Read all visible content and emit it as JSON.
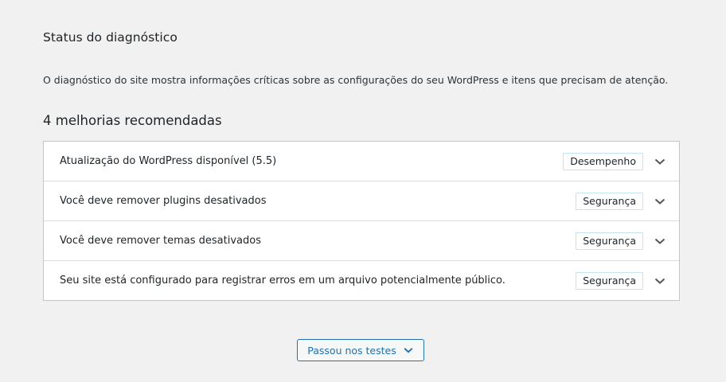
{
  "header": {
    "title": "Status do diagnóstico",
    "description": "O diagnóstico do site mostra informações críticas sobre as configurações do seu WordPress e itens que precisam de atenção."
  },
  "recommendations": {
    "title": "4 melhorias recomendadas",
    "items": [
      {
        "label": "Atualização do WordPress disponível (5.5)",
        "badge": "Desempenho",
        "icon": "chevron-down-icon"
      },
      {
        "label": "Você deve remover plugins desativados",
        "badge": "Segurança",
        "icon": "chevron-down-icon"
      },
      {
        "label": "Você deve remover temas desativados",
        "badge": "Segurança",
        "icon": "chevron-down-icon"
      },
      {
        "label": "Seu site está configurado para registrar erros em um arquivo potencialmente público.",
        "badge": "Segurança",
        "icon": "chevron-down-icon"
      }
    ]
  },
  "passed_tests": {
    "label": "Passou nos testes",
    "icon": "chevron-down-icon"
  },
  "colors": {
    "background": "#f1f1f1",
    "accent": "#2271b1",
    "badge_border": "#c3e3f0",
    "card_border": "#c3c4c7"
  }
}
